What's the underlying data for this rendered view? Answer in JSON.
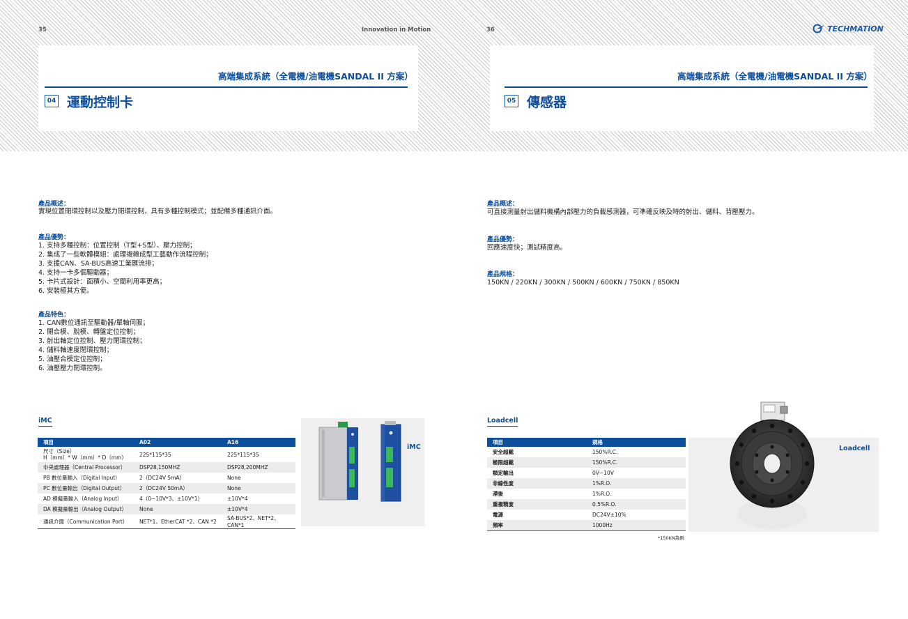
{
  "header": {
    "left_page_number": "35",
    "tagline": "Innovation in Motion",
    "right_page_number": "36",
    "logo_text": "TECHMATION",
    "section_title": "高端集成系統（全電機/油電機SANDAL II 方案）"
  },
  "left": {
    "number": "04",
    "title": "運動控制卡",
    "overview_label": "產品概述：",
    "overview_text": "實現位置閉環控制以及壓力閉環控制，具有多種控制模式；並配備多種通訊介面。",
    "advantages_label": "產品優勢：",
    "advantages": [
      "1. 支持多種控制：位置控制（T型+S型）、壓力控制；",
      "2. 集成了一些軟體模組：處理複雜成型工藝動作流程控制；",
      "3. 支援CAN、SA-BUS高速工業匯流排；",
      "4. 支持一卡多個驅動器；",
      "5. 卡片式設計：面積小、空間利用率更高；",
      "6. 安裝極其方便。"
    ],
    "features_label": "產品特色：",
    "features": [
      "1. CAN數位通訊至驅動器/單軸伺服；",
      "2. 開合模、脫模、轉盤定位控制；",
      "3. 射出軸定位控制、壓力閉環控制；",
      "4. 儲料軸速度閉環控制；",
      "5. 油壓合模定位控制；",
      "6. 油壓壓力閉環控制。"
    ],
    "product_label": "iMC",
    "product_image_label": "iMC",
    "table": {
      "headers": [
        "項目",
        "A02",
        "A16"
      ],
      "rows": [
        [
          "尺寸（Size）\nH（mm）* W（mm）* D（mm）",
          "225*115*35",
          "225*115*35"
        ],
        [
          "中央處理器（Central Processor）",
          "DSP28,150MHZ",
          "DSP28,200MHZ"
        ],
        [
          "PB 數位量輸入（Digital Input）",
          "2（DC24V 5mA）",
          "None"
        ],
        [
          "PC 數位量輸出（Digital Output）",
          "2（DC24V 50mA）",
          "None"
        ],
        [
          "AD 模擬量輸入（Analog Input）",
          "4（0~10V*3、±10V*1）",
          "±10V*4"
        ],
        [
          "DA 模擬量輸出（Analog Output）",
          "None",
          "±10V*4"
        ],
        [
          "通訊介面（Communication Port）",
          "NET*1、EtherCAT *2、CAN *2",
          "SA-BUS*2、NET*2、CAN*1"
        ]
      ]
    }
  },
  "right": {
    "number": "05",
    "title": "傳感器",
    "overview_label": "產品概述：",
    "overview_text": "可直接測量射出儲料機構內部壓力的負載感測器，可準確反映及時的射出、儲料、背壓壓力。",
    "advantages_label": "產品優勢：",
    "advantages_text": "回應速度快；測試精度高。",
    "specs_label": "產品規格：",
    "specs_text": "150KN / 220KN / 300KN / 500KN / 600KN / 750KN / 850KN",
    "product_label": "Loadcell",
    "product_image_label": "Loadcell",
    "table": {
      "headers": [
        "項目",
        "規格"
      ],
      "rows": [
        [
          "安全超載",
          "150%R.C."
        ],
        [
          "極限超載",
          "150%R.C."
        ],
        [
          "額定輸出",
          "0V~10V"
        ],
        [
          "非線性度",
          "1%R.O."
        ],
        [
          "滯後",
          "1%R.O."
        ],
        [
          "重複精度",
          "0.5%R.O."
        ],
        [
          "電源",
          "DC24V±10%"
        ],
        [
          "頻率",
          "1000Hz"
        ]
      ]
    },
    "footnote": "*150KN為例"
  }
}
